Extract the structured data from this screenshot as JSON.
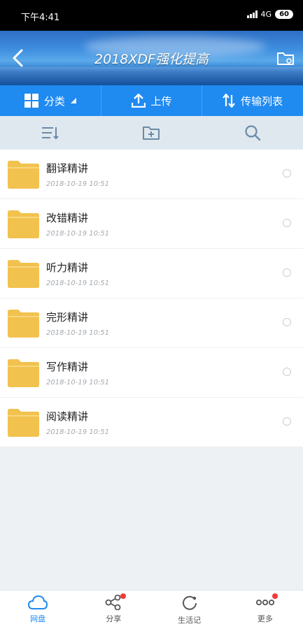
{
  "status_bar": {
    "time": "下午4:41",
    "network": "4G",
    "battery": "60"
  },
  "header": {
    "title": "2018XDF强化提高"
  },
  "actions": [
    {
      "label": "分类",
      "icon": "grid-icon"
    },
    {
      "label": "上传",
      "icon": "upload-icon"
    },
    {
      "label": "传输列表",
      "icon": "transfer-icon"
    }
  ],
  "files": [
    {
      "name": "翻译精讲",
      "date": "2018-10-19  10:51"
    },
    {
      "name": "改错精讲",
      "date": "2018-10-19  10:51"
    },
    {
      "name": "听力精讲",
      "date": "2018-10-19  10:51"
    },
    {
      "name": "完形精讲",
      "date": "2018-10-19  10:51"
    },
    {
      "name": "写作精讲",
      "date": "2018-10-19  10:51"
    },
    {
      "name": "阅读精讲",
      "date": "2018-10-19  10:51"
    }
  ],
  "bottom_nav": [
    {
      "label": "网盘",
      "icon": "cloud-icon",
      "active": true
    },
    {
      "label": "分享",
      "icon": "share-icon",
      "badge": true
    },
    {
      "label": "生活记",
      "icon": "refresh-icon"
    },
    {
      "label": "更多",
      "icon": "more-icon",
      "badge": true
    }
  ],
  "colors": {
    "accent": "#1f8af0",
    "folder": "#f2c24e",
    "badge": "#f03a3a"
  }
}
